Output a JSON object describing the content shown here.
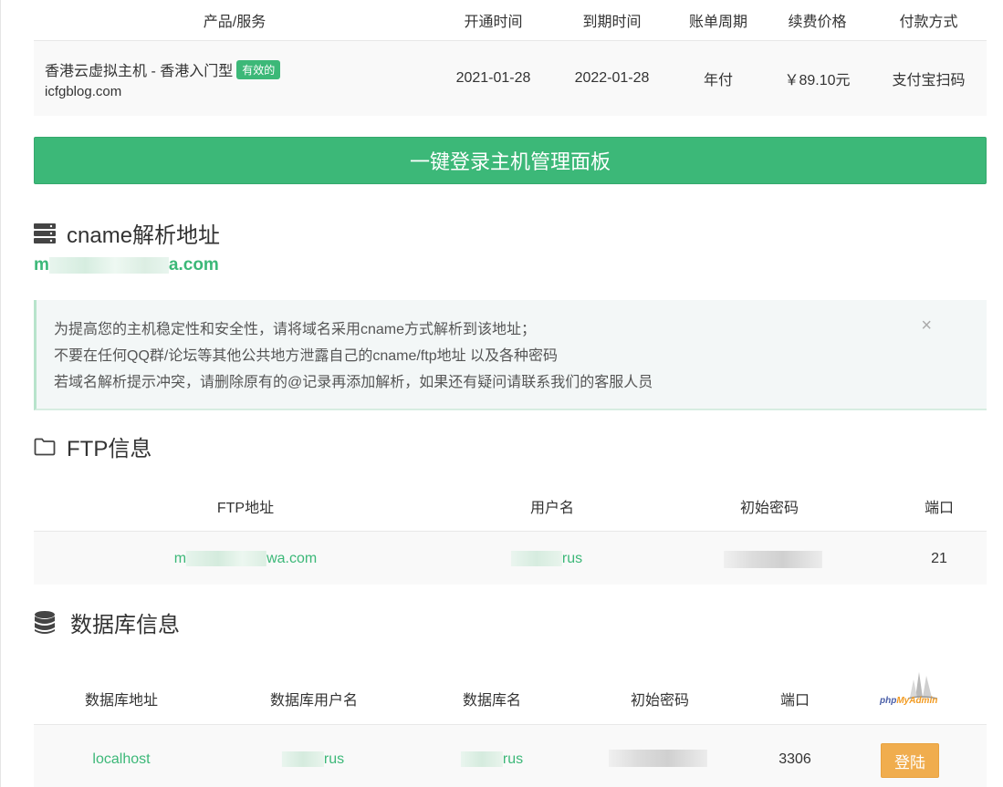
{
  "product_table": {
    "headers": [
      "产品/服务",
      "开通时间",
      "到期时间",
      "账单周期",
      "续费价格",
      "付款方式"
    ],
    "row": {
      "name": "香港云虚拟主机 - 香港入门型",
      "status": "有效的",
      "domain": "icfgblog.com",
      "start": "2021-01-28",
      "end": "2022-01-28",
      "cycle": "年付",
      "price": "￥89.10元",
      "payment": "支付宝扫码"
    }
  },
  "login_panel_button": "一键登录主机管理面板",
  "cname": {
    "title": "cname解析地址",
    "value_prefix": "m",
    "value_suffix": "a.com",
    "notice": [
      "为提高您的主机稳定性和安全性，请将域名采用cname方式解析到该地址；",
      "不要在任何QQ群/论坛等其他公共地方泄露自己的cname/ftp地址 以及各种密码",
      "若域名解析提示冲突，请删除原有的@记录再添加解析，如果还有疑问请联系我们的客服人员"
    ],
    "close": "×"
  },
  "ftp": {
    "title": "FTP信息",
    "headers": [
      "FTP地址",
      "用户名",
      "初始密码",
      "端口"
    ],
    "row": {
      "address_prefix": "m",
      "address_suffix": "wa.com",
      "username_suffix": "rus",
      "port": "21"
    }
  },
  "database": {
    "title": "数据库信息",
    "headers": [
      "数据库地址",
      "数据库用户名",
      "数据库名",
      "初始密码",
      "端口"
    ],
    "logo": "phpMyAdmin",
    "row": {
      "address": "localhost",
      "username_suffix": "rus",
      "dbname_suffix": "rus",
      "port": "3306",
      "login_label": "登陆"
    }
  },
  "colors": {
    "accent": "#3cb878",
    "warning": "#f0ad4e"
  }
}
